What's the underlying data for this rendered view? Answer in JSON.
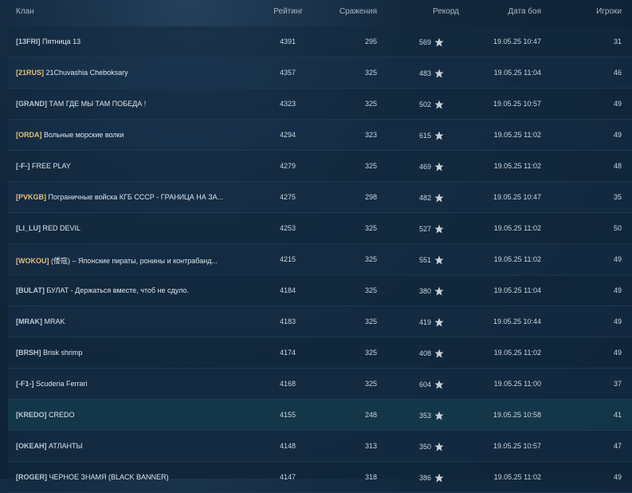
{
  "header": {
    "clan": "Клан",
    "rating": "Рейтинг",
    "battles": "Сражения",
    "record": "Рекорд",
    "date": "Дата боя",
    "players": "Игроки"
  },
  "rows": [
    {
      "tag": "[13FRI]",
      "name": "Пятница 13",
      "rating": "4391",
      "battles": "295",
      "record": "569",
      "date": "19.05.25 10:47",
      "players": "31",
      "gold": false
    },
    {
      "tag": "[21RUS]",
      "name": "21Chuvashia Cheboksary",
      "rating": "4357",
      "battles": "325",
      "record": "483",
      "date": "19.05.25 11:04",
      "players": "46",
      "gold": true
    },
    {
      "tag": "[GRAND]",
      "name": "ТАМ ГДЕ МЫ ТАМ ПОБЕДА !",
      "rating": "4323",
      "battles": "325",
      "record": "502",
      "date": "19.05.25 10:57",
      "players": "49",
      "gold": false
    },
    {
      "tag": "[ORDA]",
      "name": "Вольные морские волки",
      "rating": "4294",
      "battles": "323",
      "record": "615",
      "date": "19.05.25 11:02",
      "players": "49",
      "gold": true
    },
    {
      "tag": "[-F-]",
      "name": "FREE PLAY",
      "rating": "4279",
      "battles": "325",
      "record": "469",
      "date": "19.05.25 11:02",
      "players": "48",
      "gold": false
    },
    {
      "tag": "[PVKGB]",
      "name": "Пограничные войска КГБ СССР - ГРАНИЦА НА ЗА...",
      "rating": "4275",
      "battles": "298",
      "record": "482",
      "date": "19.05.25 10:47",
      "players": "35",
      "gold": true
    },
    {
      "tag": "[LI_LU]",
      "name": "RED DEVIL",
      "rating": "4253",
      "battles": "325",
      "record": "527",
      "date": "19.05.25 11:02",
      "players": "50",
      "gold": false
    },
    {
      "tag": "[WOKOU]",
      "name": "(倭寇) – Японские пираты, ронины и контрабанд...",
      "rating": "4215",
      "battles": "325",
      "record": "551",
      "date": "19.05.25 11:02",
      "players": "49",
      "gold": true
    },
    {
      "tag": "[BULAT]",
      "name": "БУЛАТ - Держаться вместе, чтоб не сдуло.",
      "rating": "4184",
      "battles": "325",
      "record": "380",
      "date": "19.05.25 11:04",
      "players": "49",
      "gold": false
    },
    {
      "tag": "[MRAK]",
      "name": "MRAK",
      "rating": "4183",
      "battles": "325",
      "record": "419",
      "date": "19.05.25 10:44",
      "players": "49",
      "gold": false
    },
    {
      "tag": "[BRSH]",
      "name": "Brisk shrimp",
      "rating": "4174",
      "battles": "325",
      "record": "408",
      "date": "19.05.25 11:02",
      "players": "49",
      "gold": false
    },
    {
      "tag": "[-F1-]",
      "name": "Scuderia Ferrari",
      "rating": "4168",
      "battles": "325",
      "record": "604",
      "date": "19.05.25 11:00",
      "players": "37",
      "gold": false
    },
    {
      "tag": "[KREDO]",
      "name": "CREDO",
      "rating": "4155",
      "battles": "248",
      "record": "353",
      "date": "19.05.25 10:58",
      "players": "41",
      "gold": false
    },
    {
      "tag": "[OKEAH]",
      "name": "АТЛАНТЫ",
      "rating": "4148",
      "battles": "313",
      "record": "350",
      "date": "19.05.25 10:57",
      "players": "47",
      "gold": false
    },
    {
      "tag": "[ROGER]",
      "name": "ЧЕРНОЕ ЗНАМЯ (BLACK BANNER)",
      "rating": "4147",
      "battles": "318",
      "record": "386",
      "date": "19.05.25 11:02",
      "players": "49",
      "gold": false
    }
  ],
  "highlight_row_index": 12,
  "icons": {
    "record": "star-icon"
  },
  "colors": {
    "gold_tag": "#e3c07a",
    "highlight_row": "#143a4c"
  }
}
